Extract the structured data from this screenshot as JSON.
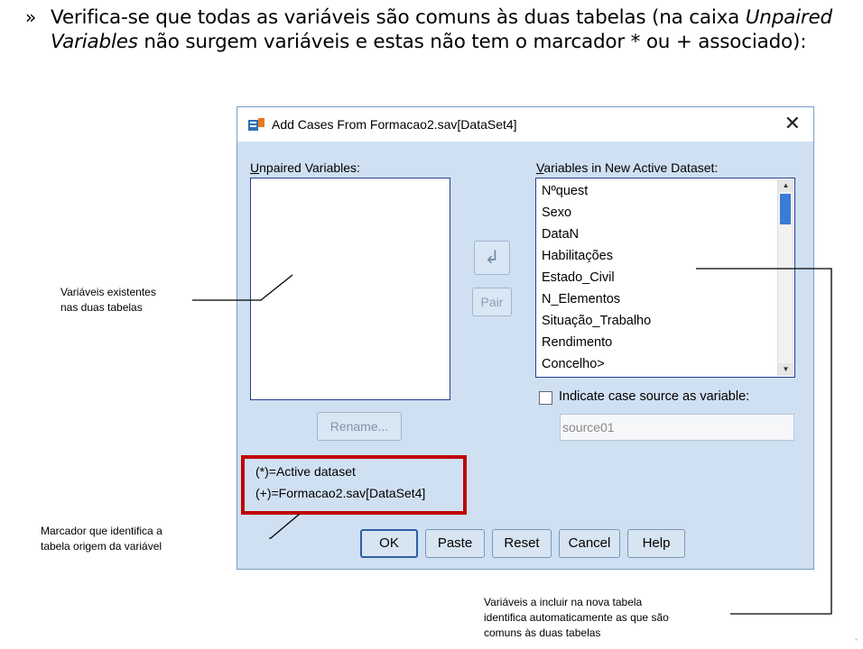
{
  "slide": {
    "bullet": "»",
    "text_pre": "Verifica-se que todas as variáveis são comuns às duas tabelas (na caixa ",
    "text_italic": "Unpaired Variables",
    "text_post": " não surgem variáveis e estas não tem o marcador * ou + associado):"
  },
  "dialog": {
    "title": "Add Cases From Formacao2.sav[DataSet4]",
    "close_glyph": "✕",
    "unpaired_label": "Unpaired Variables:",
    "unpaired_label_accel": "U",
    "unpaired_label_rest": "npaired Variables:",
    "new_vars_label_accel": "V",
    "new_vars_label_rest": "ariables in New Active Dataset:",
    "new_vars": [
      "Nºquest",
      "Sexo",
      "DataN",
      "Habilitações",
      "Estado_Civil",
      "N_Elementos",
      "Situação_Trabalho",
      "Rendimento",
      "Concelho>"
    ],
    "move_arrow_glyph": "↲",
    "pair_label": "Pair",
    "rename_label": "Rename...",
    "indicate_label": "Indicate case source as variable:",
    "indicate_checked": false,
    "source_value": "source01",
    "legend_active": "(*)=Active dataset",
    "legend_other": "(+)=Formacao2.sav[DataSet4]",
    "buttons": {
      "ok": "OK",
      "paste": "Paste",
      "reset": "Reset",
      "cancel": "Cancel",
      "help": "Help"
    }
  },
  "annotations": {
    "left_top": [
      "Variáveis existentes",
      "nas duas tabelas"
    ],
    "left_bottom": [
      "Marcador que identifica a",
      "tabela origem da variável"
    ],
    "right_bottom": [
      "Variáveis a incluir na nova tabela",
      "identifica automaticamente as que são",
      "comuns às duas tabelas"
    ]
  },
  "colors": {
    "dialog_bg": "#cfe0f2",
    "highlight_border": "#c00000",
    "list_border": "#2a3b8f",
    "scroll_thumb": "#3a7bd5"
  }
}
